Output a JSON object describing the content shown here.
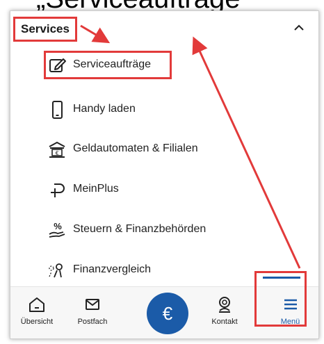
{
  "caption": "„Serviceaufträge“",
  "services": {
    "title": "Services",
    "items": [
      {
        "label": "Serviceaufträge",
        "icon": "edit-icon"
      },
      {
        "label": "Handy laden",
        "icon": "phone-icon"
      },
      {
        "label": "Geldautomaten & Filialen",
        "icon": "bank-icon"
      },
      {
        "label": "MeinPlus",
        "icon": "plus-p-icon"
      },
      {
        "label": "Steuern & Finanzbehörden",
        "icon": "percent-hand-icon"
      },
      {
        "label": "Finanzvergleich",
        "icon": "compare-people-icon"
      }
    ]
  },
  "tabs": [
    {
      "label": "Übersicht",
      "icon": "home-icon"
    },
    {
      "label": "Postfach",
      "icon": "mail-icon"
    },
    {
      "label": "€",
      "icon": "euro-icon"
    },
    {
      "label": "Kontakt",
      "icon": "contact-icon"
    },
    {
      "label": "Menü",
      "icon": "menu-icon"
    }
  ],
  "colors": {
    "accent": "#1b5ba8",
    "annotation": "#e23a3a"
  }
}
